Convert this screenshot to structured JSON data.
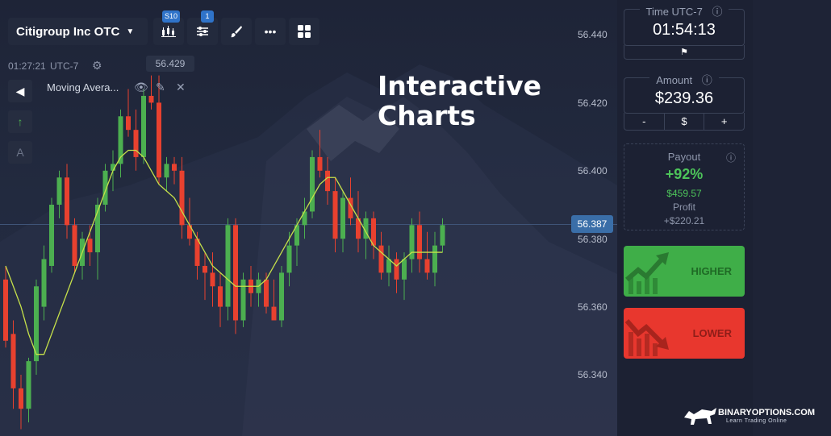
{
  "toolbar": {
    "asset": "Citigroup Inc OTC",
    "chart_type_badge": "S10",
    "indicators_badge": "1"
  },
  "chart_info": {
    "time": "01:27:21",
    "timezone": "UTC-7",
    "hover_price": "56.429"
  },
  "indicator": {
    "name": "Moving Avera..."
  },
  "side_tools": {
    "text_tool": "A"
  },
  "watermark": [
    "Interactive",
    "Charts"
  ],
  "price_axis": [
    "56.440",
    "56.420",
    "56.400",
    "56.380",
    "56.360",
    "56.340"
  ],
  "current_price": "56.387",
  "time_panel": {
    "label": "Time UTC-7",
    "value": "01:54:13"
  },
  "amount_panel": {
    "label": "Amount",
    "value": "$239.36",
    "minus": "-",
    "currency": "$",
    "plus": "+"
  },
  "payout_panel": {
    "label": "Payout",
    "percent": "+92%",
    "amount": "$459.57",
    "profit_label": "Profit",
    "profit_value": "+$220.21"
  },
  "buttons": {
    "higher": "HIGHER",
    "lower": "LOWER"
  },
  "brand": {
    "name": "BINARYOPTIONS.COM",
    "tagline": "Learn Trading Online"
  },
  "colors": {
    "up": "#4caf50",
    "down": "#e8412f",
    "ma": "#c5e04a",
    "accent": "#2f73c9"
  },
  "chart_data": {
    "type": "candlestick",
    "ylim": [
      56.33,
      56.448
    ],
    "candles": [
      {
        "o": 56.368,
        "h": 56.372,
        "l": 56.348,
        "c": 56.35,
        "d": "down"
      },
      {
        "o": 56.352,
        "h": 56.356,
        "l": 56.33,
        "c": 56.336,
        "d": "down"
      },
      {
        "o": 56.336,
        "h": 56.34,
        "l": 56.324,
        "c": 56.33,
        "d": "down"
      },
      {
        "o": 56.33,
        "h": 56.345,
        "l": 56.326,
        "c": 56.344,
        "d": "up"
      },
      {
        "o": 56.344,
        "h": 56.368,
        "l": 56.34,
        "c": 56.366,
        "d": "up"
      },
      {
        "o": 56.36,
        "h": 56.378,
        "l": 56.356,
        "c": 56.374,
        "d": "up"
      },
      {
        "o": 56.372,
        "h": 56.392,
        "l": 56.37,
        "c": 56.39,
        "d": "up"
      },
      {
        "o": 56.39,
        "h": 56.4,
        "l": 56.386,
        "c": 56.398,
        "d": "up"
      },
      {
        "o": 56.398,
        "h": 56.402,
        "l": 56.38,
        "c": 56.384,
        "d": "down"
      },
      {
        "o": 56.384,
        "h": 56.386,
        "l": 56.37,
        "c": 56.372,
        "d": "down"
      },
      {
        "o": 56.372,
        "h": 56.382,
        "l": 56.368,
        "c": 56.38,
        "d": "up"
      },
      {
        "o": 56.38,
        "h": 56.384,
        "l": 56.372,
        "c": 56.376,
        "d": "down"
      },
      {
        "o": 56.376,
        "h": 56.392,
        "l": 56.368,
        "c": 56.39,
        "d": "up"
      },
      {
        "o": 56.39,
        "h": 56.402,
        "l": 56.388,
        "c": 56.4,
        "d": "up"
      },
      {
        "o": 56.4,
        "h": 56.406,
        "l": 56.394,
        "c": 56.402,
        "d": "up"
      },
      {
        "o": 56.402,
        "h": 56.418,
        "l": 56.398,
        "c": 56.416,
        "d": "up"
      },
      {
        "o": 56.416,
        "h": 56.424,
        "l": 56.41,
        "c": 56.412,
        "d": "down"
      },
      {
        "o": 56.412,
        "h": 56.418,
        "l": 56.4,
        "c": 56.404,
        "d": "down"
      },
      {
        "o": 56.404,
        "h": 56.424,
        "l": 56.402,
        "c": 56.422,
        "d": "up"
      },
      {
        "o": 56.422,
        "h": 56.428,
        "l": 56.418,
        "c": 56.42,
        "d": "down"
      },
      {
        "o": 56.42,
        "h": 56.428,
        "l": 56.396,
        "c": 56.398,
        "d": "down"
      },
      {
        "o": 56.398,
        "h": 56.404,
        "l": 56.394,
        "c": 56.402,
        "d": "up"
      },
      {
        "o": 56.402,
        "h": 56.404,
        "l": 56.396,
        "c": 56.4,
        "d": "down"
      },
      {
        "o": 56.4,
        "h": 56.404,
        "l": 56.38,
        "c": 56.384,
        "d": "down"
      },
      {
        "o": 56.384,
        "h": 56.392,
        "l": 56.378,
        "c": 56.38,
        "d": "down"
      },
      {
        "o": 56.38,
        "h": 56.382,
        "l": 56.368,
        "c": 56.372,
        "d": "down"
      },
      {
        "o": 56.372,
        "h": 56.376,
        "l": 56.362,
        "c": 56.37,
        "d": "down"
      },
      {
        "o": 56.37,
        "h": 56.376,
        "l": 56.36,
        "c": 56.366,
        "d": "down"
      },
      {
        "o": 56.366,
        "h": 56.37,
        "l": 56.354,
        "c": 56.36,
        "d": "down"
      },
      {
        "o": 56.36,
        "h": 56.386,
        "l": 56.356,
        "c": 56.384,
        "d": "up"
      },
      {
        "o": 56.384,
        "h": 56.386,
        "l": 56.352,
        "c": 56.356,
        "d": "down"
      },
      {
        "o": 56.356,
        "h": 56.37,
        "l": 56.354,
        "c": 56.368,
        "d": "up"
      },
      {
        "o": 56.368,
        "h": 56.372,
        "l": 56.36,
        "c": 56.364,
        "d": "down"
      },
      {
        "o": 56.364,
        "h": 56.37,
        "l": 56.36,
        "c": 56.368,
        "d": "up"
      },
      {
        "o": 56.368,
        "h": 56.37,
        "l": 56.358,
        "c": 56.36,
        "d": "down"
      },
      {
        "o": 56.36,
        "h": 56.368,
        "l": 56.356,
        "c": 56.356,
        "d": "down"
      },
      {
        "o": 56.356,
        "h": 56.372,
        "l": 56.354,
        "c": 56.37,
        "d": "up"
      },
      {
        "o": 56.37,
        "h": 56.382,
        "l": 56.366,
        "c": 56.378,
        "d": "up"
      },
      {
        "o": 56.378,
        "h": 56.386,
        "l": 56.372,
        "c": 56.384,
        "d": "up"
      },
      {
        "o": 56.384,
        "h": 56.392,
        "l": 56.38,
        "c": 56.388,
        "d": "up"
      },
      {
        "o": 56.388,
        "h": 56.406,
        "l": 56.386,
        "c": 56.404,
        "d": "up"
      },
      {
        "o": 56.404,
        "h": 56.412,
        "l": 56.398,
        "c": 56.4,
        "d": "down"
      },
      {
        "o": 56.4,
        "h": 56.404,
        "l": 56.39,
        "c": 56.394,
        "d": "down"
      },
      {
        "o": 56.394,
        "h": 56.398,
        "l": 56.376,
        "c": 56.38,
        "d": "down"
      },
      {
        "o": 56.38,
        "h": 56.394,
        "l": 56.376,
        "c": 56.392,
        "d": "up"
      },
      {
        "o": 56.392,
        "h": 56.398,
        "l": 56.384,
        "c": 56.386,
        "d": "down"
      },
      {
        "o": 56.386,
        "h": 56.394,
        "l": 56.376,
        "c": 56.38,
        "d": "down"
      },
      {
        "o": 56.38,
        "h": 56.388,
        "l": 56.374,
        "c": 56.386,
        "d": "up"
      },
      {
        "o": 56.386,
        "h": 56.388,
        "l": 56.374,
        "c": 56.378,
        "d": "down"
      },
      {
        "o": 56.378,
        "h": 56.382,
        "l": 56.368,
        "c": 56.37,
        "d": "down"
      },
      {
        "o": 56.37,
        "h": 56.378,
        "l": 56.366,
        "c": 56.374,
        "d": "up"
      },
      {
        "o": 56.374,
        "h": 56.376,
        "l": 56.364,
        "c": 56.368,
        "d": "down"
      },
      {
        "o": 56.368,
        "h": 56.376,
        "l": 56.362,
        "c": 56.374,
        "d": "up"
      },
      {
        "o": 56.374,
        "h": 56.386,
        "l": 56.37,
        "c": 56.384,
        "d": "up"
      },
      {
        "o": 56.384,
        "h": 56.388,
        "l": 56.37,
        "c": 56.374,
        "d": "down"
      },
      {
        "o": 56.374,
        "h": 56.382,
        "l": 56.368,
        "c": 56.37,
        "d": "down"
      },
      {
        "o": 56.37,
        "h": 56.382,
        "l": 56.366,
        "c": 56.378,
        "d": "up"
      },
      {
        "o": 56.378,
        "h": 56.386,
        "l": 56.376,
        "c": 56.384,
        "d": "up"
      }
    ],
    "moving_average": [
      56.372,
      56.366,
      56.36,
      56.352,
      56.346,
      56.346,
      56.352,
      56.358,
      56.364,
      56.37,
      56.376,
      56.382,
      56.388,
      56.394,
      56.4,
      56.404,
      56.406,
      56.406,
      56.404,
      56.4,
      56.396,
      56.394,
      56.392,
      56.388,
      56.384,
      56.38,
      56.376,
      56.372,
      56.37,
      56.368,
      56.366,
      56.366,
      56.366,
      56.366,
      56.368,
      56.372,
      56.376,
      56.38,
      56.384,
      56.388,
      56.392,
      56.396,
      56.398,
      56.398,
      56.394,
      56.39,
      56.386,
      56.382,
      56.378,
      56.376,
      56.374,
      56.372,
      56.374,
      56.376,
      56.376,
      56.376,
      56.376,
      56.376
    ]
  }
}
